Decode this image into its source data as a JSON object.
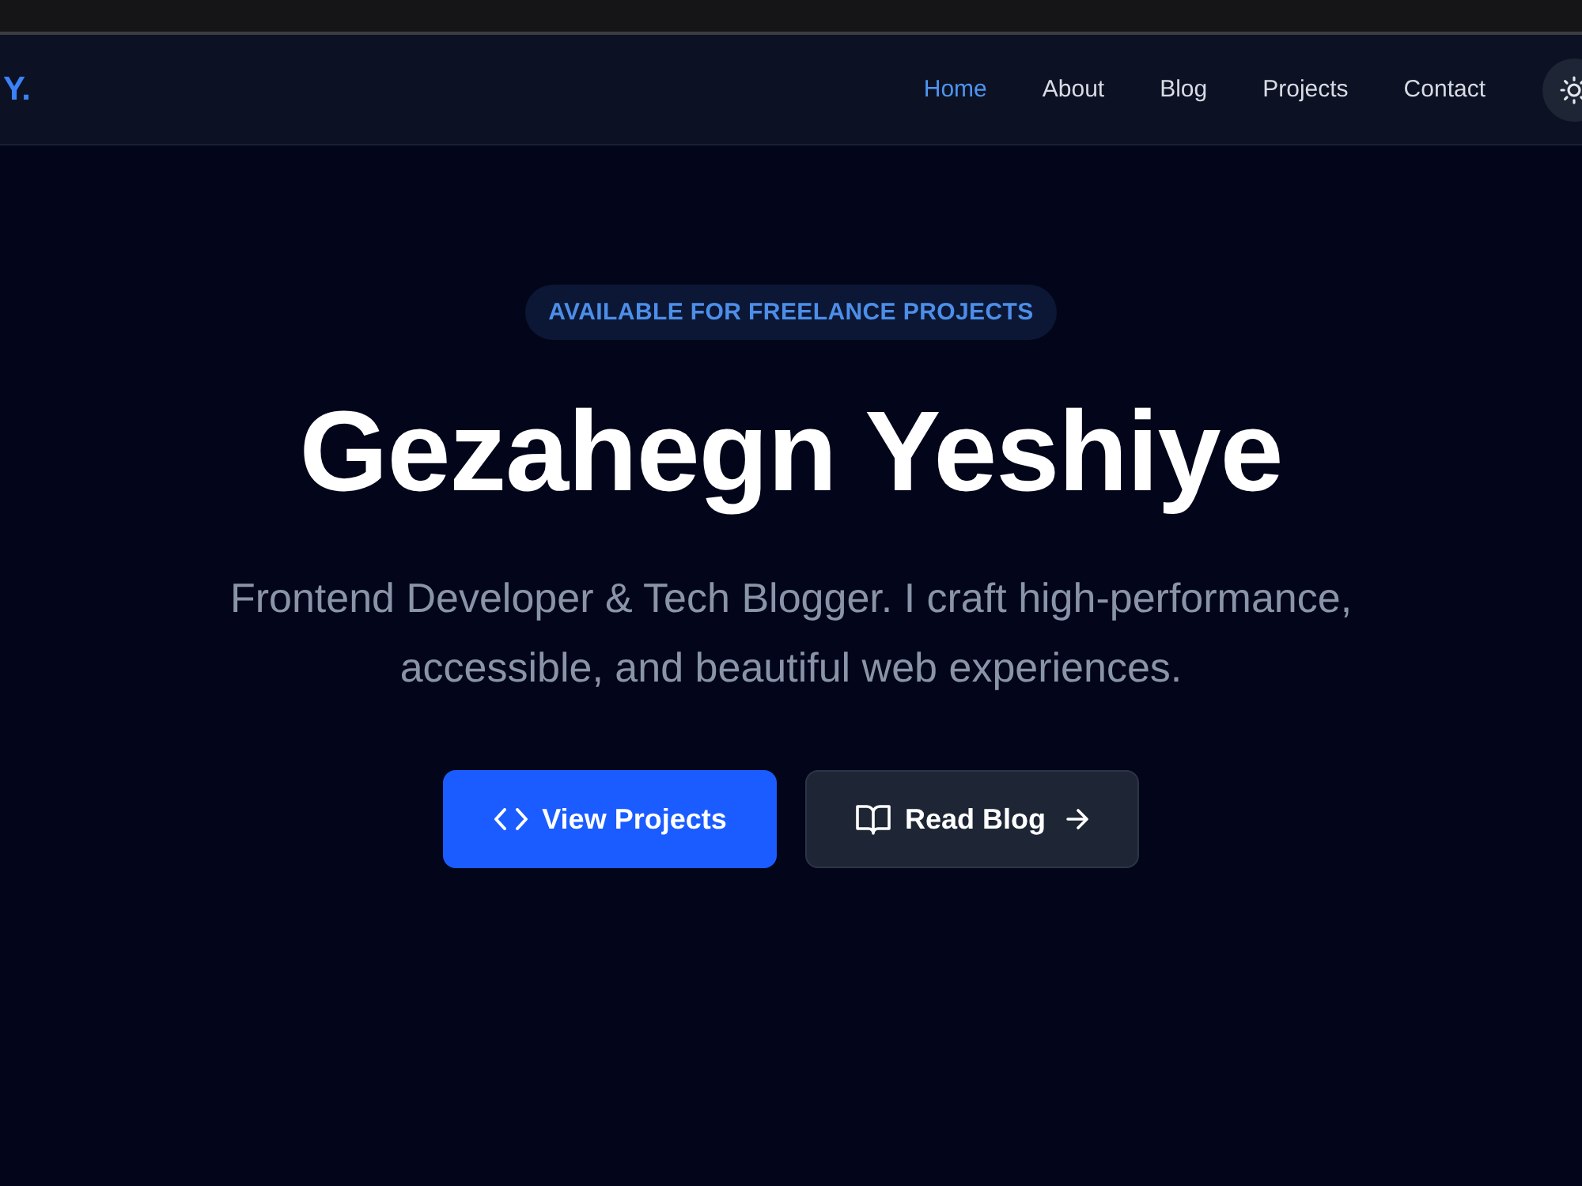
{
  "navbar": {
    "logo": "Y.",
    "links": [
      {
        "label": "Home",
        "selected": true
      },
      {
        "label": "About",
        "selected": false
      },
      {
        "label": "Blog",
        "selected": false
      },
      {
        "label": "Projects",
        "selected": false
      },
      {
        "label": "Contact",
        "selected": false
      }
    ]
  },
  "hero": {
    "badge": "AVAILABLE FOR FREELANCE PROJECTS",
    "title": "Gezahegn Yeshiye",
    "subtitle": "Frontend Developer & Tech Blogger. I craft high-performance, accessible, and beautiful web experiences.",
    "buttons": [
      {
        "label": "View Projects",
        "kind": "primary"
      },
      {
        "label": "Read Blog",
        "kind": "secondary"
      }
    ]
  }
}
